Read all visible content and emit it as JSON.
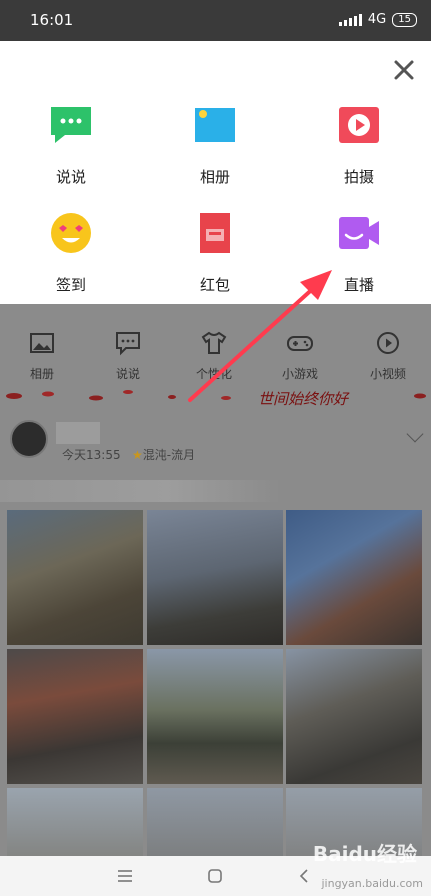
{
  "status_bar": {
    "time": "16:01",
    "network": "4G",
    "network_sub": "ıl",
    "battery": "15"
  },
  "panel": {
    "items": [
      {
        "label": "说说",
        "icon": "talk-icon"
      },
      {
        "label": "相册",
        "icon": "album-icon"
      },
      {
        "label": "拍摄",
        "icon": "camera-icon"
      },
      {
        "label": "签到",
        "icon": "checkin-icon"
      },
      {
        "label": "红包",
        "icon": "red-envelope-icon"
      },
      {
        "label": "直播",
        "icon": "live-icon"
      }
    ],
    "colors": {
      "talk": "#2dc26a",
      "album": "#2ab0e8",
      "camera": "#f04a5a",
      "checkin": "#f8c51c",
      "red_envelope": "#e8434b",
      "live": "#b05bf0"
    }
  },
  "feed_bar": {
    "items": [
      {
        "label": "相册",
        "icon": "picture-icon"
      },
      {
        "label": "说说",
        "icon": "message-icon"
      },
      {
        "label": "个性化",
        "icon": "shirt-icon"
      },
      {
        "label": "小游戏",
        "icon": "gamepad-icon"
      },
      {
        "label": "小视频",
        "icon": "video-icon"
      }
    ]
  },
  "post": {
    "banner": "世间始终你好",
    "time": "今天13:55",
    "tag": "混沌-流月"
  },
  "watermark": {
    "big": "Baidu经验",
    "small": "jingyan.baidu.com"
  }
}
